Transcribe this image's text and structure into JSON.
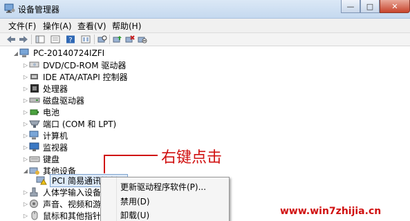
{
  "window": {
    "title": "设备管理器",
    "minimize_glyph": "—",
    "maximize_glyph": "□",
    "close_glyph": "✕"
  },
  "menu": {
    "items": [
      "文件(F)",
      "操作(A)",
      "查看(V)",
      "帮助(H)"
    ]
  },
  "toolbar": {
    "icons": [
      "back-arrow-icon",
      "forward-arrow-icon",
      "show-hide-console-tree-icon",
      "properties-icon",
      "help-icon",
      "view-icon",
      "scan-hardware-icon",
      "update-driver-icon",
      "uninstall-icon",
      "disable-device-icon"
    ]
  },
  "tree": {
    "root": "PC-20140724IZFI",
    "categories": [
      {
        "label": "DVD/CD-ROM 驱动器",
        "icon": "dvd-drive-icon"
      },
      {
        "label": "IDE ATA/ATAPI 控制器",
        "icon": "ide-controller-icon"
      },
      {
        "label": "处理器",
        "icon": "processor-icon"
      },
      {
        "label": "磁盘驱动器",
        "icon": "disk-drive-icon"
      },
      {
        "label": "电池",
        "icon": "battery-icon"
      },
      {
        "label": "端口 (COM 和 LPT)",
        "icon": "port-icon"
      },
      {
        "label": "计算机",
        "icon": "computer-icon"
      },
      {
        "label": "监视器",
        "icon": "monitor-icon"
      },
      {
        "label": "键盘",
        "icon": "keyboard-icon"
      },
      {
        "label": "其他设备",
        "icon": "other-devices-icon"
      }
    ],
    "selected_child": "PCI 简易通讯控制器",
    "after": [
      {
        "label": "人体学输入设备",
        "icon": "hid-icon"
      },
      {
        "label": "声音、视频和游戏",
        "icon": "sound-icon"
      },
      {
        "label": "鼠标和其他指针",
        "icon": "mouse-icon"
      }
    ]
  },
  "context_menu": {
    "items": [
      "更新驱动程序软件(P)...",
      "禁用(D)",
      "卸载(U)"
    ]
  },
  "annotation": {
    "text": "右键点击",
    "color": "#d01010"
  },
  "watermark": {
    "text": "www.win7zhijia.cn"
  }
}
